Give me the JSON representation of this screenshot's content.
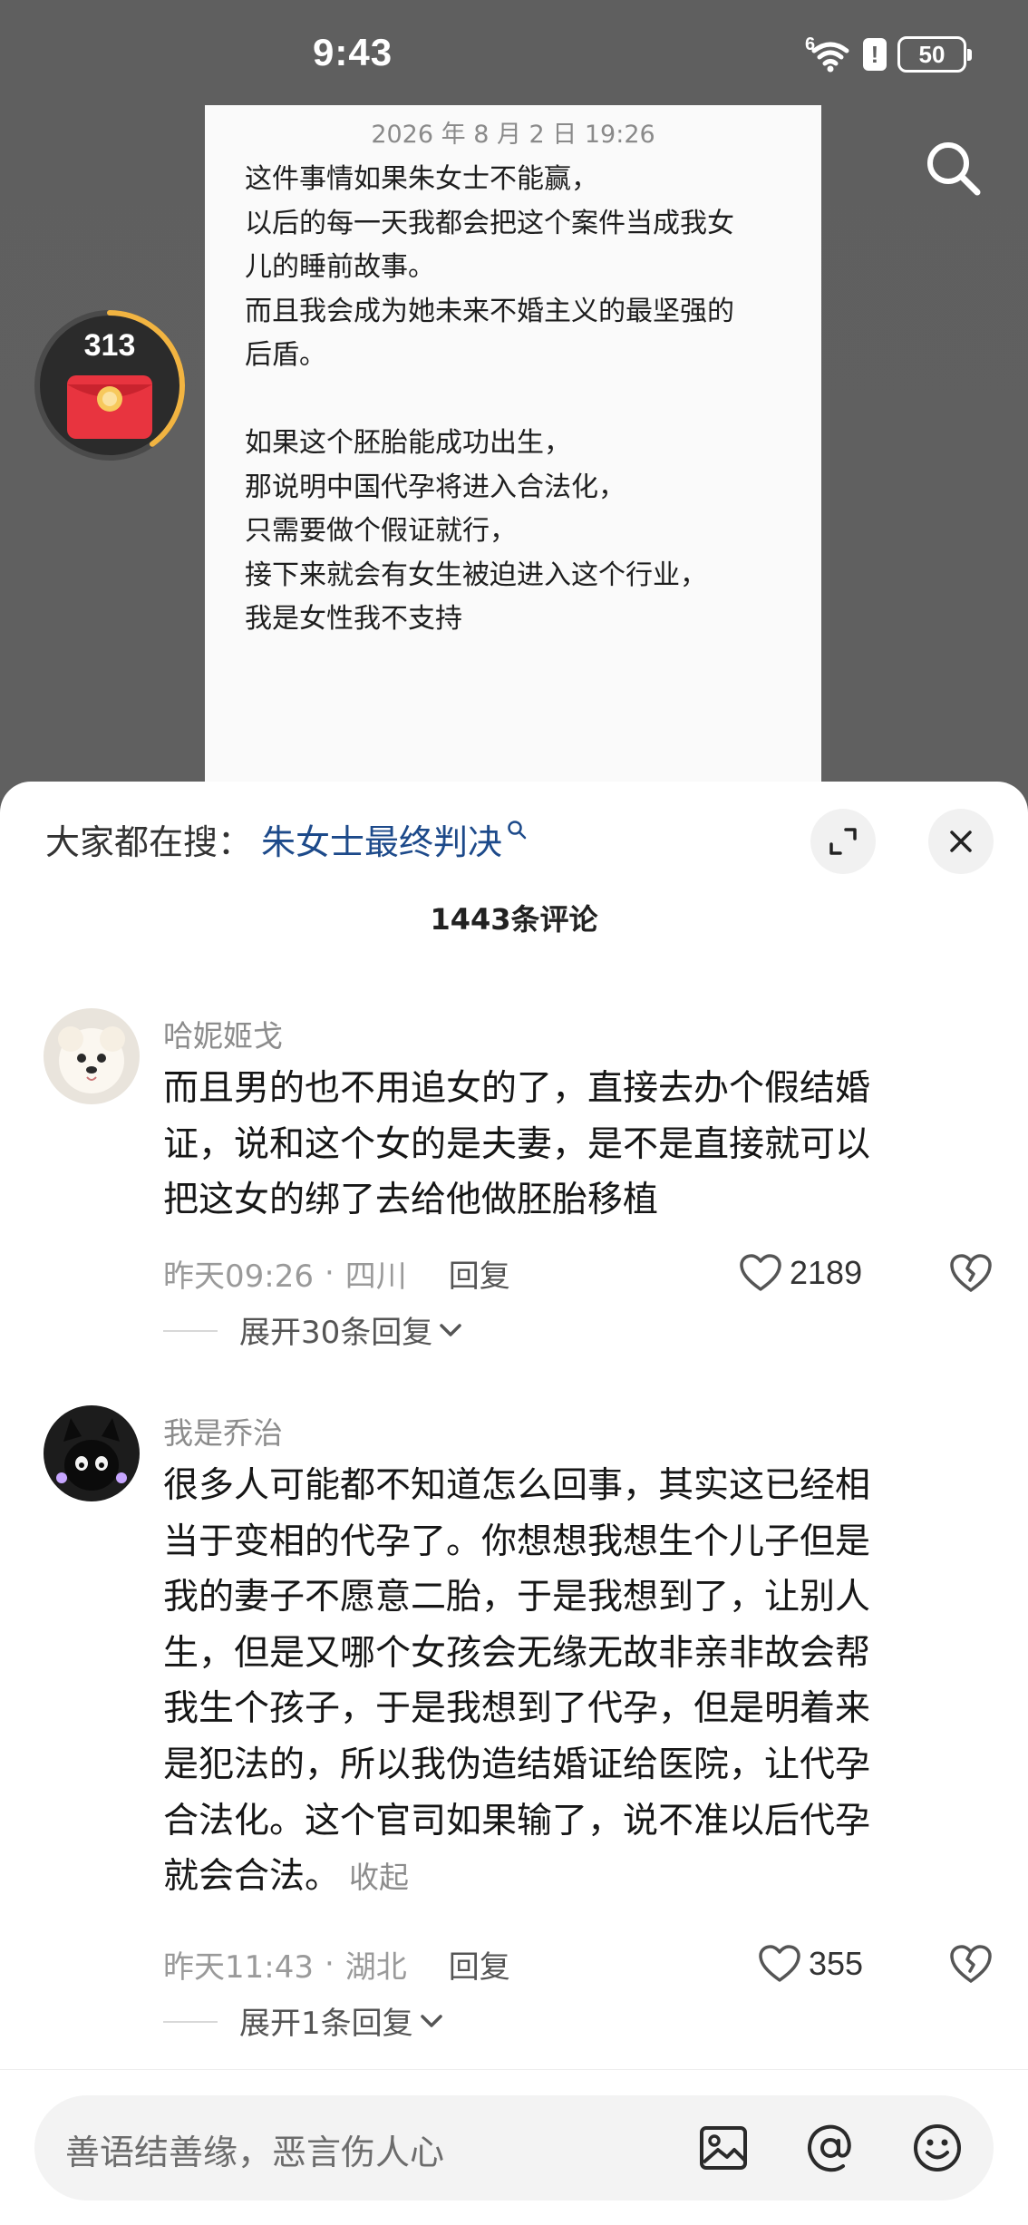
{
  "status_bar": {
    "time": "9:43",
    "network_label": "6",
    "alert_label": "!",
    "battery": "50"
  },
  "note": {
    "date": "2026 年 8 月 2 日 19:26",
    "lines": [
      "这件事情如果朱女士不能赢，",
      "以后的每一天我都会把这个案件当成我女",
      "儿的睡前故事。",
      "而且我会成为她未来不婚主义的最坚强的",
      "后盾。",
      "",
      "如果这个胚胎能成功出生，",
      "那说明中国代孕将进入合法化，",
      "只需要做个假证就行，",
      "接下来就会有女生被迫进入这个行业，",
      "我是女性我不支持"
    ]
  },
  "red_packet": {
    "count": "313",
    "progress": 0.4
  },
  "sheet": {
    "search_prefix": "大家都在搜：",
    "search_term": "朱女士最终判决",
    "comment_count": "1443条评论"
  },
  "comments": [
    {
      "username": "哈妮姬戈",
      "lines": [
        "而且男的也不用追女的了，直接去办个假结婚",
        "证，说和这个女的是夫妻，是不是直接就可以",
        "把这女的绑了去给他做胚胎移植"
      ],
      "time": "昨天09:26",
      "location": "四川",
      "reply": "回复",
      "likes": "2189",
      "expand": "展开30条回复"
    },
    {
      "username": "我是乔治",
      "lines": [
        "很多人可能都不知道怎么回事，其实这已经相",
        "当于变相的代孕了。你想想我想生个儿子但是",
        "我的妻子不愿意二胎，于是我想到了，让别人",
        "生，但是又哪个女孩会无缘无故非亲非故会帮",
        "我生个孩子，于是我想到了代孕，但是明着来",
        "是犯法的，所以我伪造结婚证给医院，让代孕",
        "合法化。这个官司如果输了，说不准以后代孕",
        "就会合法。"
      ],
      "collapse": "收起",
      "time": "昨天11:43",
      "location": "湖北",
      "reply": "回复",
      "likes": "355",
      "expand": "展开1条回复"
    }
  ],
  "input": {
    "placeholder": "善语结善缘，恶言伤人心"
  },
  "icons": {
    "wifi": "wifi-icon",
    "search": "search-icon",
    "expand": "expand-icon",
    "close": "close-icon",
    "heart": "heart-icon",
    "dislike": "broken-heart-icon",
    "chevron": "chevron-down-icon",
    "image": "image-icon",
    "mention": "at-icon",
    "emoji": "emoji-icon"
  },
  "colors": {
    "search_term": "#1d4a8a",
    "red_packet": "#e8343f",
    "ring": "#f2b441"
  }
}
